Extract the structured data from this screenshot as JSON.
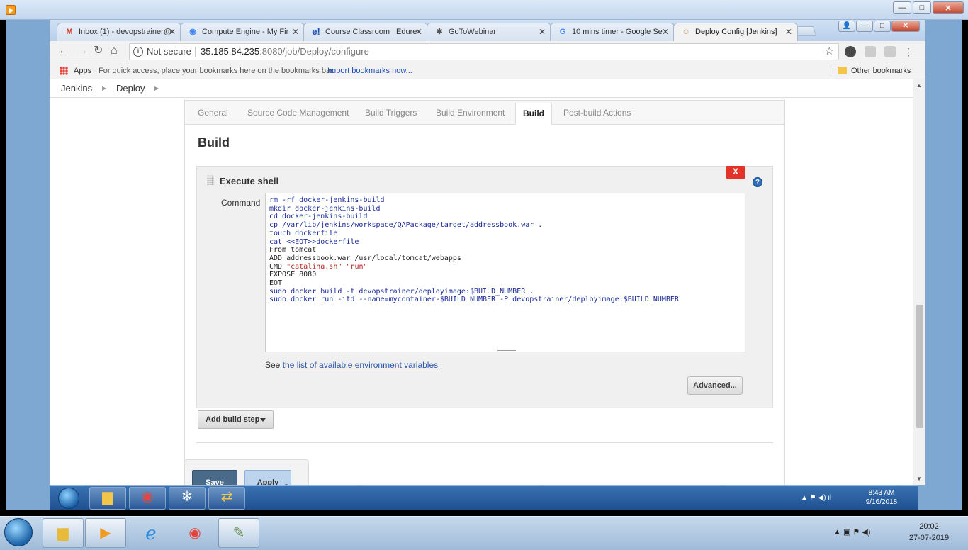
{
  "host_window": {
    "close_label": "✕",
    "minimize_label": "—",
    "maximize_label": "□"
  },
  "browser": {
    "tabs": [
      {
        "label": "Inbox (1) - devopstrainer@",
        "icon": "gmail-icon",
        "color": "#d93025",
        "glyph": "M"
      },
      {
        "label": "Compute Engine - My Fir",
        "icon": "gcp-icon",
        "color": "#4285f4",
        "glyph": "◉"
      },
      {
        "label": "Course Classroom | Edure",
        "icon": "edureka-icon",
        "color": "#1a4fb5",
        "glyph": "e!"
      },
      {
        "label": "GoToWebinar",
        "icon": "gotowebinar-icon",
        "color": "#555555",
        "glyph": "✱"
      },
      {
        "label": "10 mins timer - Google Se",
        "icon": "google-icon",
        "color": "#4285f4",
        "glyph": "G"
      },
      {
        "label": "Deploy Config [Jenkins]",
        "icon": "jenkins-icon",
        "color": "#c48a5c",
        "glyph": "☺"
      }
    ],
    "tab_close": "✕",
    "window_ctrls": {
      "user": "👤",
      "minimize": "—",
      "maximize": "□",
      "close": "✕"
    },
    "nav": {
      "back": "←",
      "forward": "→",
      "reload": "↻",
      "home": "⌂"
    },
    "url": {
      "security": "Not secure",
      "host": "35.185.84.235",
      "path": ":8080/job/Deploy/configure"
    },
    "bookmarks": {
      "apps": "Apps",
      "hint": "For quick access, place your bookmarks here on the bookmarks bar.",
      "import": "Import bookmarks now...",
      "other": "Other bookmarks"
    }
  },
  "jenkins": {
    "breadcrumb": [
      "Jenkins",
      "Deploy"
    ],
    "config_tabs": [
      "General",
      "Source Code Management",
      "Build Triggers",
      "Build Environment",
      "Build",
      "Post-build Actions"
    ],
    "active_tab": "Build",
    "section_title": "Build",
    "step": {
      "title": "Execute shell",
      "delete_label": "X",
      "help_label": "?",
      "command_label": "Command",
      "command_lines": [
        "rm -rf docker-jenkins-build",
        "mkdir docker-jenkins-build",
        "cd docker-jenkins-build",
        "cp /var/lib/jenkins/workspace/QAPackage/target/addressbook.war .",
        "touch dockerfile",
        "cat <<EOT>>dockerfile",
        "From tomcat",
        "ADD addressbook.war /usr/local/tomcat/webapps",
        "CMD \"catalina.sh\" \"run\"",
        "EXPOSE 8080",
        "EOT",
        "sudo docker build -t devopstrainer/deployimage:$BUILD_NUMBER .",
        "sudo docker run -itd --name=mycontainer-$BUILD_NUMBER -P devopstrainer/deployimage:$BUILD_NUMBER"
      ],
      "see_prefix": "See ",
      "see_link": "the list of available environment variables",
      "advanced_label": "Advanced..."
    },
    "add_build_step_label": "Add build step",
    "save_label": "Save",
    "apply_label": "Apply"
  },
  "inner_taskbar": {
    "clock_time": "8:43 AM",
    "clock_date": "9/16/2018"
  },
  "outer_taskbar": {
    "clock_time": "20:02",
    "clock_date": "27-07-2019"
  }
}
